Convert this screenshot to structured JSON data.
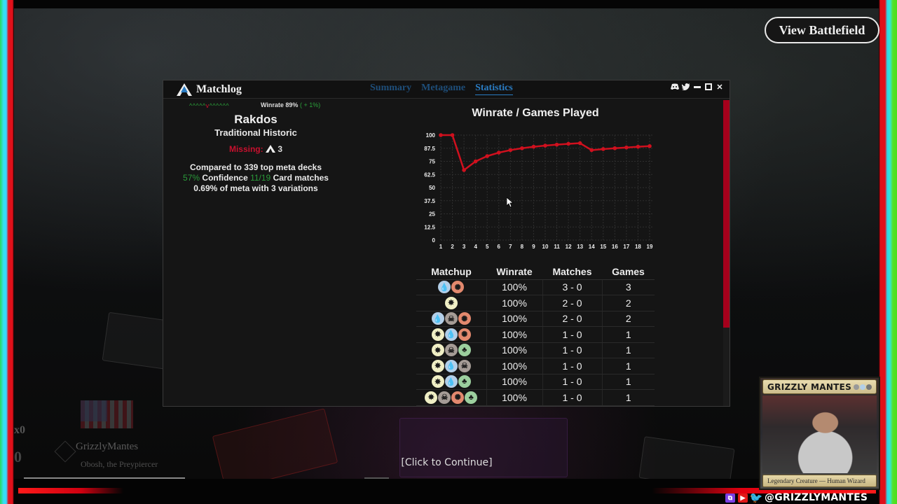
{
  "overlay": {
    "view_battlefield_label": "View Battlefield",
    "click_to_continue": "[Click to Continue]",
    "player": {
      "name": "GrizzlyMantes",
      "commander": "Obosh, the Preypiercer",
      "hourglass_count": "x0",
      "life": "0"
    },
    "webcam": {
      "name": "GRIZZLY MANTES",
      "type_line": "Legendary Creature — Human Wizard"
    },
    "social": {
      "handle": "@GRIZZLYMANTES",
      "icons": [
        "twitch-icon",
        "youtube-icon",
        "twitter-icon"
      ]
    }
  },
  "matchlog": {
    "title": "Matchlog",
    "tabs": [
      {
        "label": "Summary",
        "active": false
      },
      {
        "label": "Metagame",
        "active": false
      },
      {
        "label": "Statistics",
        "active": true
      }
    ],
    "controls": [
      "discord-icon",
      "twitter-icon",
      "minimize-icon",
      "maximize-icon",
      "close-icon"
    ],
    "deck": {
      "streak": [
        "W",
        "W",
        "W",
        "W",
        "W",
        "L",
        "W",
        "W",
        "W",
        "W",
        "W",
        "W"
      ],
      "winrate_label": "Winrate 89%",
      "winrate_delta": "( + 1%)",
      "name": "Rakdos",
      "format": "Traditional Historic",
      "missing_label": "Missing:",
      "missing_count": "3",
      "compared_text": "Compared to 339 top meta decks",
      "confidence_pct": "57%",
      "confidence_label": "Confidence",
      "card_matches": "11/19",
      "card_matches_label": "Card matches",
      "meta_text": "0.69% of meta with 3 variations"
    },
    "colors": {
      "accent_blue": "#2a7cc3",
      "loss_red": "#c8102e",
      "win_green": "#2aa03a",
      "scrollbar": "#a5001c"
    },
    "matchups": {
      "headers": [
        "Matchup",
        "Winrate",
        "Matches",
        "Games"
      ],
      "rows": [
        {
          "colors": [
            "U",
            "R"
          ],
          "winrate": "100%",
          "matches": "3 - 0",
          "games": "3"
        },
        {
          "colors": [
            "W"
          ],
          "winrate": "100%",
          "matches": "2 - 0",
          "games": "2"
        },
        {
          "colors": [
            "U",
            "B",
            "R"
          ],
          "winrate": "100%",
          "matches": "2 - 0",
          "games": "2"
        },
        {
          "colors": [
            "W",
            "U",
            "R"
          ],
          "winrate": "100%",
          "matches": "1 - 0",
          "games": "1"
        },
        {
          "colors": [
            "W",
            "B",
            "G"
          ],
          "winrate": "100%",
          "matches": "1 - 0",
          "games": "1"
        },
        {
          "colors": [
            "W",
            "U",
            "B"
          ],
          "winrate": "100%",
          "matches": "1 - 0",
          "games": "1"
        },
        {
          "colors": [
            "W",
            "U",
            "G"
          ],
          "winrate": "100%",
          "matches": "1 - 0",
          "games": "1"
        },
        {
          "colors": [
            "W",
            "B",
            "R",
            "G"
          ],
          "winrate": "100%",
          "matches": "1 - 0",
          "games": "1"
        }
      ]
    }
  },
  "chart_data": {
    "type": "line",
    "title": "Winrate / Games Played",
    "xlabel": "",
    "ylabel": "",
    "x": [
      1,
      2,
      3,
      4,
      5,
      6,
      7,
      8,
      9,
      10,
      11,
      12,
      13,
      14,
      15,
      16,
      17,
      18,
      19
    ],
    "series": [
      {
        "name": "Winrate",
        "color": "#d0101e",
        "values": [
          100,
          100,
          66.7,
          75,
          80,
          83.3,
          85.7,
          87.5,
          88.9,
          90,
          90.9,
          91.7,
          92.3,
          85.7,
          86.7,
          87.5,
          88.2,
          88.9,
          89.5
        ]
      }
    ],
    "yticks": [
      0,
      12.5,
      25,
      37.5,
      50,
      62.5,
      75,
      87.5,
      100
    ],
    "xticks": [
      1,
      2,
      3,
      4,
      5,
      6,
      7,
      8,
      9,
      10,
      11,
      12,
      13,
      14,
      15,
      16,
      17,
      18,
      19
    ],
    "ylim": [
      0,
      100
    ],
    "xlim": [
      1,
      19
    ],
    "grid": true,
    "legend": "none"
  }
}
